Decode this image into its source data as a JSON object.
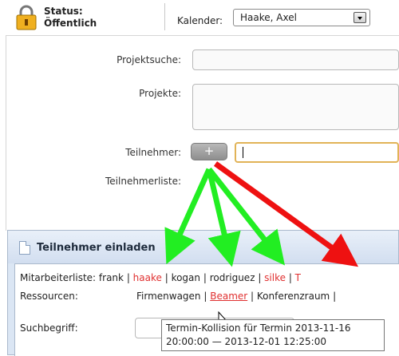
{
  "status": {
    "label": "Status:",
    "value": "Öffentlich"
  },
  "kalender": {
    "label": "Kalender:",
    "selected": "Haake, Axel"
  },
  "form": {
    "projektsuche_label": "Projektsuche:",
    "projekte_label": "Projekte:",
    "teilnehmer_label": "Teilnehmer:",
    "add_button": "+",
    "teilnehmerliste_label": "Teilnehmerliste:"
  },
  "dialog": {
    "title": "Teilnehmer einladen",
    "mitarbeiter_label": "Mitarbeiterliste:",
    "mitarbeiter": [
      {
        "name": "frank",
        "color": "#222222"
      },
      {
        "name": "haake",
        "color": "#e03030"
      },
      {
        "name": "kogan",
        "color": "#222222"
      },
      {
        "name": "rodriguez",
        "color": "#222222"
      },
      {
        "name": "silke",
        "color": "#e03030"
      },
      {
        "name": "T",
        "color": "#e03030"
      }
    ],
    "ressourcen_label": "Ressourcen:",
    "ressourcen": [
      {
        "name": "Firmenwagen",
        "color": "#222222"
      },
      {
        "name": "Beamer",
        "color": "#e03030"
      },
      {
        "name": "Konferenzraum",
        "color": "#222222"
      }
    ],
    "suchbegriff_label": "Suchbegriff:"
  },
  "tooltip": {
    "line1": "Termin-Kollision für Termin 2013-11-16",
    "line2": "20:00:00 — 2013-12-01 12:25:00"
  },
  "colors": {
    "green_arrow": "#22ee22",
    "red_arrow": "#ee1111",
    "accent": "#e1b357"
  }
}
